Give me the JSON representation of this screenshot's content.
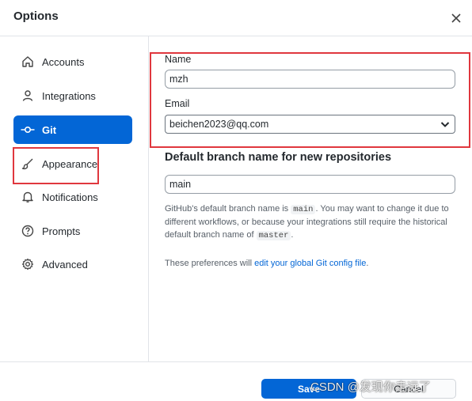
{
  "dialog": {
    "title": "Options"
  },
  "sidebar": {
    "items": [
      {
        "label": "Accounts",
        "icon": "home-icon"
      },
      {
        "label": "Integrations",
        "icon": "person-icon"
      },
      {
        "label": "Git",
        "icon": "git-commit-icon",
        "active": true
      },
      {
        "label": "Appearance",
        "icon": "paintbrush-icon"
      },
      {
        "label": "Notifications",
        "icon": "bell-icon"
      },
      {
        "label": "Prompts",
        "icon": "question-icon"
      },
      {
        "label": "Advanced",
        "icon": "gear-icon"
      }
    ]
  },
  "git": {
    "name_label": "Name",
    "name_value": "mzh",
    "email_label": "Email",
    "email_value": "beichen2023@qq.com",
    "branch_heading": "Default branch name for new repositories",
    "branch_value": "main",
    "help_part1": "GitHub's default branch name is ",
    "help_code1": "main",
    "help_part2": ". You may want to change it due to different workflows, or because your integrations still require the historical default branch name of ",
    "help_code2": "master",
    "help_part3": ".",
    "prefs_prefix": "These preferences will ",
    "prefs_link": "edit your global Git config file",
    "prefs_suffix": "."
  },
  "footer": {
    "save_label": "Save",
    "cancel_label": "Cancel",
    "watermark": "CSDN @发现你走远了"
  },
  "colors": {
    "accent": "#0366d6",
    "highlight_box": "#e0373e"
  }
}
